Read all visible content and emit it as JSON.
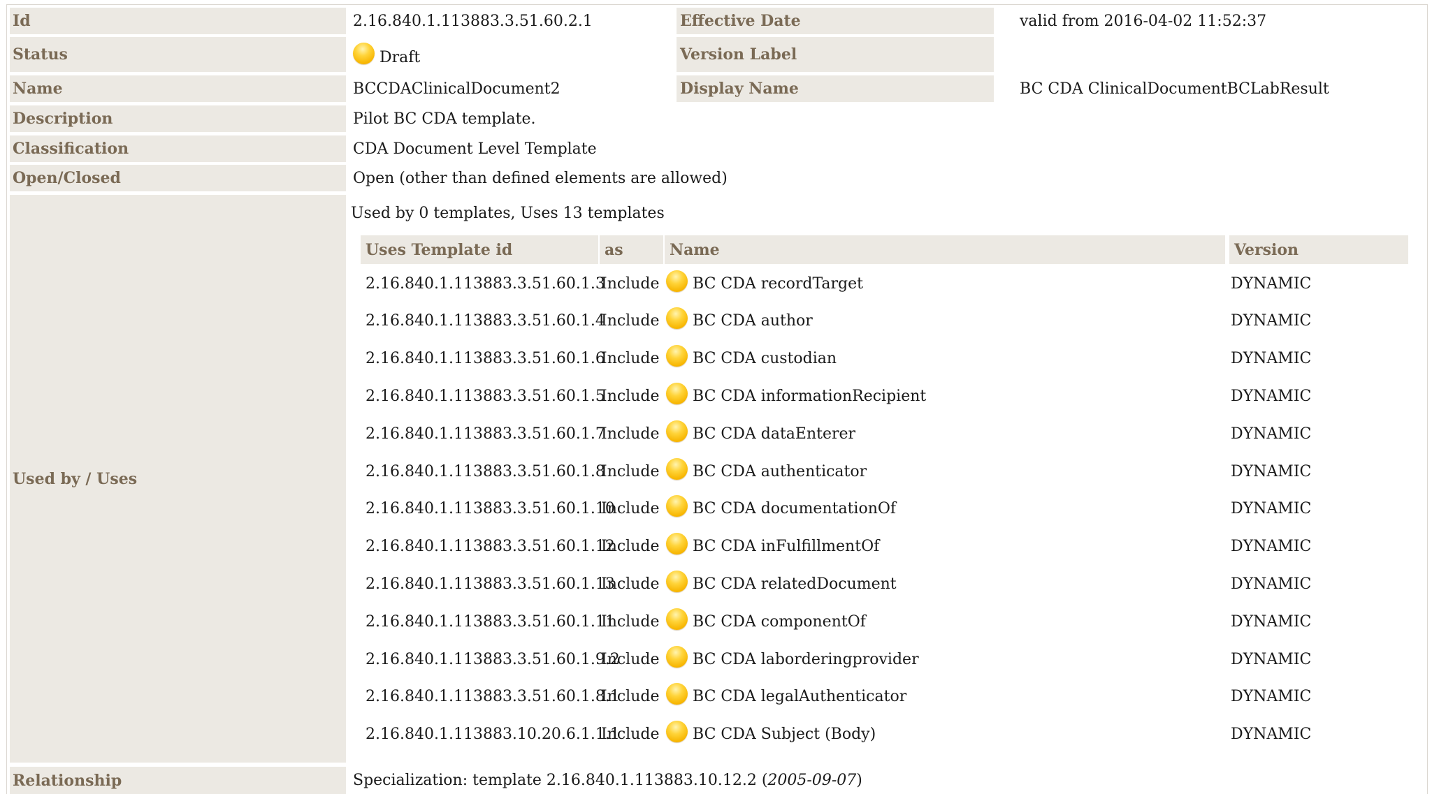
{
  "fields": {
    "id": {
      "label": "Id",
      "value": "2.16.840.1.113883.3.51.60.2.1"
    },
    "effective_date": {
      "label": "Effective Date",
      "value": "valid from 2016-04-02 11:52:37"
    },
    "status": {
      "label": "Status",
      "value": "Draft",
      "icon": "draft-status-icon",
      "color": "#f7b500"
    },
    "version_label": {
      "label": "Version Label",
      "value": ""
    },
    "name": {
      "label": "Name",
      "value": "BCCDAClinicalDocument2"
    },
    "display_name": {
      "label": "Display Name",
      "value": "BC CDA ClinicalDocumentBCLabResult"
    },
    "description": {
      "label": "Description",
      "value": "Pilot BC CDA template."
    },
    "classification": {
      "label": "Classification",
      "value": "CDA Document Level Template"
    },
    "open_closed": {
      "label": "Open/Closed",
      "value": "Open (other than defined elements are allowed)"
    },
    "used_by_uses": {
      "label": "Used by / Uses",
      "summary": "Used by 0 templates, Uses 13 templates"
    },
    "relationship": {
      "label": "Relationship",
      "prefix": "Specialization: template 2.16.840.1.113883.10.12.2 (",
      "date": "2005-09-07",
      "suffix": ")"
    }
  },
  "uses_table": {
    "columns": [
      "Uses Template id",
      "as",
      "Name",
      "Version"
    ],
    "rows": [
      {
        "id": "2.16.840.1.113883.3.51.60.1.3",
        "as": "Include",
        "name": "BC CDA recordTarget",
        "version": "DYNAMIC"
      },
      {
        "id": "2.16.840.1.113883.3.51.60.1.4",
        "as": "Include",
        "name": "BC CDA author",
        "version": "DYNAMIC"
      },
      {
        "id": "2.16.840.1.113883.3.51.60.1.6",
        "as": "Include",
        "name": "BC CDA custodian",
        "version": "DYNAMIC"
      },
      {
        "id": "2.16.840.1.113883.3.51.60.1.5",
        "as": "Include",
        "name": "BC CDA informationRecipient",
        "version": "DYNAMIC"
      },
      {
        "id": "2.16.840.1.113883.3.51.60.1.7",
        "as": "Include",
        "name": "BC CDA dataEnterer",
        "version": "DYNAMIC"
      },
      {
        "id": "2.16.840.1.113883.3.51.60.1.8",
        "as": "Include",
        "name": "BC CDA authenticator",
        "version": "DYNAMIC"
      },
      {
        "id": "2.16.840.1.113883.3.51.60.1.10",
        "as": "Include",
        "name": "BC CDA documentationOf",
        "version": "DYNAMIC"
      },
      {
        "id": "2.16.840.1.113883.3.51.60.1.12",
        "as": "Include",
        "name": "BC CDA inFulfillmentOf",
        "version": "DYNAMIC"
      },
      {
        "id": "2.16.840.1.113883.3.51.60.1.13",
        "as": "Include",
        "name": "BC CDA relatedDocument",
        "version": "DYNAMIC"
      },
      {
        "id": "2.16.840.1.113883.3.51.60.1.11",
        "as": "Include",
        "name": "BC CDA componentOf",
        "version": "DYNAMIC"
      },
      {
        "id": "2.16.840.1.113883.3.51.60.1.9.2",
        "as": "Include",
        "name": "BC CDA laborderingprovider",
        "version": "DYNAMIC"
      },
      {
        "id": "2.16.840.1.113883.3.51.60.1.8.1",
        "as": "Include",
        "name": "BC CDA legalAuthenticator",
        "version": "DYNAMIC"
      },
      {
        "id": "2.16.840.1.113883.10.20.6.1.1.1",
        "as": "Include",
        "name": "BC CDA Subject (Body)",
        "version": "DYNAMIC"
      }
    ]
  },
  "colors": {
    "label_bg": "#ece9e3",
    "label_text": "#7a6a55",
    "status_draft": "#f7b500"
  }
}
